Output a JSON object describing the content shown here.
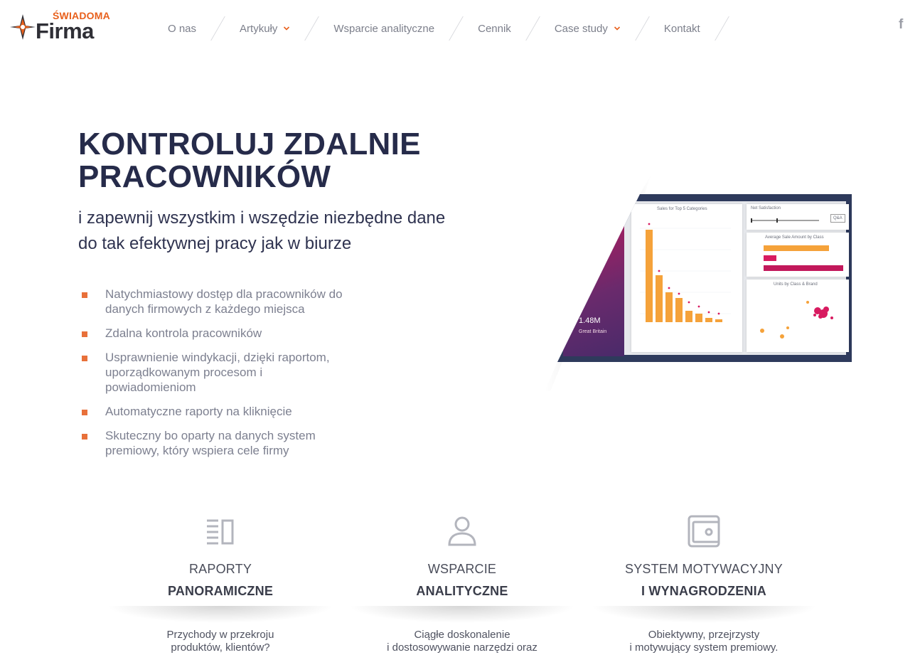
{
  "logo": {
    "top_text": "ŚWIADOMA",
    "main_text": "Firma"
  },
  "nav": {
    "items": [
      {
        "label": "O nas",
        "dropdown": false
      },
      {
        "label": "Artykuły",
        "dropdown": true
      },
      {
        "label": "Wsparcie analityczne",
        "dropdown": false
      },
      {
        "label": "Cennik",
        "dropdown": false
      },
      {
        "label": "Case study",
        "dropdown": true
      },
      {
        "label": "Kontakt",
        "dropdown": false
      }
    ]
  },
  "social": {
    "facebook_glyph": "f",
    "icon": "facebook-icon"
  },
  "hero": {
    "title_line1": "KONTROLUJ ZDALNIE",
    "title_line2": "PRACOWNIKÓW",
    "subtitle_line1": "i zapewnij wszystkim i wszędzie niezbędne dane",
    "subtitle_line2": "do tak efektywnej pracy jak w biurze",
    "bullets": [
      "Natychmiastowy dostęp dla pracowników do danych firmowych z każdego miejsca",
      "Zdalna kontrola pracowników",
      "Usprawnienie windykacji, dzięki raportom, uporządkowanym procesom i powiadomieniom",
      "Automatyczne raporty na kliknięcie",
      "Skuteczny bo oparty na danych system premiowy, który wspiera cele firmy"
    ]
  },
  "dashboard": {
    "kpi_value": "1.48M",
    "kpi_label": "Great Britain",
    "sales_title": "Sales for Top 5 Categories",
    "avg_title": "Average Sale Amount by Class",
    "units_title": "Units by Class & Brand",
    "qa_label": "Q&A",
    "slider_label": "Net Satisfaction"
  },
  "features": [
    {
      "icon": "report-icon",
      "line1": "RAPORTY",
      "line2": "PANORAMICZNE",
      "desc_line1": "Przychody w przekroju",
      "desc_line2": "produktów, klientów?"
    },
    {
      "icon": "user-icon",
      "line1": "WSPARCIE",
      "line2": "ANALITYCZNE",
      "desc_line1": "Ciągłe doskonalenie",
      "desc_line2": "i dostosowywanie narzędzi oraz"
    },
    {
      "icon": "wallet-icon",
      "line1": "SYSTEM MOTYWACYJNY",
      "line2": "I WYNAGRODZENIA",
      "desc_line1": "Obiektywny, przejrzysty",
      "desc_line2": "i motywujący system premiowy."
    }
  ],
  "colors": {
    "accent": "#e8601c",
    "navy": "#262b4a",
    "bullet": "#e8703a",
    "bar": "#f5a23a",
    "magenta": "#c2185b"
  }
}
